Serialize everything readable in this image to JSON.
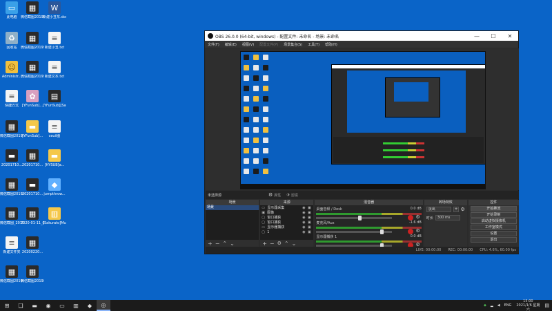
{
  "desktop": {
    "icons": [
      {
        "label": "此电脑",
        "glyph": "▭",
        "cls": "g-pc"
      },
      {
        "label": "微信截图2019年11月...",
        "glyph": "▦",
        "cls": "g-img"
      },
      {
        "label": "新建小丑东.docx",
        "glyph": "W",
        "cls": "g-word"
      },
      {
        "label": "回收站",
        "glyph": "♻",
        "cls": "g-bin"
      },
      {
        "label": "微信截图2019年11月...",
        "glyph": "▦",
        "cls": "g-img"
      },
      {
        "label": "新建小丑.txt",
        "glyph": "≡",
        "cls": "g-file"
      },
      {
        "label": "Administr...",
        "glyph": "☺",
        "cls": "g-user"
      },
      {
        "label": "微信截图2019年12月14...",
        "glyph": "▦",
        "cls": "g-img"
      },
      {
        "label": "新建文本.txt",
        "glyph": "≡",
        "cls": "g-file"
      },
      {
        "label": "快捷方式",
        "glyph": "≡",
        "cls": "g-file"
      },
      {
        "label": "[YFunSub]...",
        "glyph": "✿",
        "cls": "g-pic"
      },
      {
        "label": "[YFunSub][Sayfhon...",
        "glyph": "▤",
        "cls": "g-img"
      },
      {
        "label": "微信截图2019年10月26...",
        "glyph": "▦",
        "cls": "g-img"
      },
      {
        "label": "[YFunSub]...",
        "glyph": "▬",
        "cls": "g-folder"
      },
      {
        "label": "ceuii图",
        "glyph": "≡",
        "cls": "g-file"
      },
      {
        "label": "20201710...",
        "glyph": "▬",
        "cls": "g-img"
      },
      {
        "label": "20201710...",
        "glyph": "▦",
        "cls": "g-img"
      },
      {
        "label": "[HYSUB]a...",
        "glyph": "▬",
        "cls": "g-folder"
      },
      {
        "label": "微信截图2019年11月...",
        "glyph": "▦",
        "cls": "g-img"
      },
      {
        "label": "20201710...",
        "glyph": "▬",
        "cls": "g-img"
      },
      {
        "label": "jumpthrow...",
        "glyph": "◆",
        "cls": "g-app"
      },
      {
        "label": "微信截图_20191...",
        "glyph": "▦",
        "cls": "g-img"
      },
      {
        "label": "2020-01-11_03-31-36...",
        "glyph": "▦",
        "cls": "g-img"
      },
      {
        "label": "[Sakurato]Mushoku...",
        "glyph": "▥",
        "cls": "g-folder"
      },
      {
        "label": "新建文件夹",
        "glyph": "≡",
        "cls": "g-file"
      },
      {
        "label": "20200220...",
        "glyph": "▦",
        "cls": "g-img"
      },
      {
        "label": "微信截图2019年11月...",
        "glyph": "▦",
        "cls": "g-img"
      },
      {
        "label": "微信截图2019年11月...",
        "glyph": "▦",
        "cls": "g-img"
      }
    ]
  },
  "obs": {
    "title": "OBS 26.0.0 (64-bit, windows) - 配置文件: 未命名 - 场景: 未命名",
    "window_buttons": {
      "minimize": "—",
      "maximize": "☐",
      "close": "✕"
    },
    "menu": [
      "文件(F)",
      "编辑(E)",
      "视图(V)",
      "配置文件(P)",
      "场景集合(S)",
      "工具(T)",
      "帮助(H)"
    ],
    "menu_disabled_index": 3,
    "source_bar": {
      "label": "未选择源",
      "properties": "属性",
      "filters": "滤镜"
    },
    "docks": {
      "scenes": {
        "title": "场景",
        "items": [
          "场景"
        ]
      },
      "sources": {
        "title": "来源",
        "items": [
          {
            "name": "显示器采集",
            "icon": "▭"
          },
          {
            "name": "图像",
            "icon": "▣"
          },
          {
            "name": "窗口捕获",
            "icon": "▢"
          },
          {
            "name": "窗口捕获",
            "icon": "▢"
          },
          {
            "name": "显示器捕获",
            "icon": "▭"
          },
          {
            "name": "1",
            "icon": "▢"
          }
        ]
      },
      "mixer": {
        "title": "混音器",
        "tracks": [
          {
            "name": "桌面音频 / Desk",
            "db": "0.0 dB",
            "level": 0.55
          },
          {
            "name": "麦克风/Aux",
            "db": "-1.6 dB",
            "level": 0.84
          },
          {
            "name": "显示器捕获 1",
            "db": "0.0 dB",
            "level": 0.84
          }
        ]
      },
      "transitions": {
        "title": "转场特效",
        "selected": "淡出",
        "duration_label": "时长",
        "duration_value": "300 ms"
      },
      "controls": {
        "title": "控件",
        "buttons": [
          "开始推流",
          "开始录制",
          "启动虚拟摄像机",
          "工作室模式",
          "设置",
          "退出"
        ]
      }
    },
    "status": {
      "live": "LIVE: 00:00:00",
      "rec": "REC: 00:00:00",
      "cpu": "CPU: 4.6%, 60.00 fps"
    }
  },
  "taskbar": {
    "items": [
      {
        "name": "start",
        "glyph": "⊞"
      },
      {
        "name": "task-view",
        "glyph": "❑"
      },
      {
        "name": "file-explorer",
        "glyph": "▬"
      },
      {
        "name": "browser",
        "glyph": "◉"
      },
      {
        "name": "app-window",
        "glyph": "▭"
      },
      {
        "name": "folder-app",
        "glyph": "▥"
      },
      {
        "name": "steam",
        "glyph": "◆"
      },
      {
        "name": "obs",
        "glyph": "◎"
      }
    ],
    "active_index": 7,
    "tray": {
      "lang": "ENG",
      "time": "15:00",
      "date": "2021/1/6 星期六"
    }
  },
  "colors": {
    "desktop_bg": "#0a64c8",
    "obs_dark": "#2b2b2b",
    "mute_red": "#cc2222",
    "meter_green": "#2f9a2f"
  }
}
